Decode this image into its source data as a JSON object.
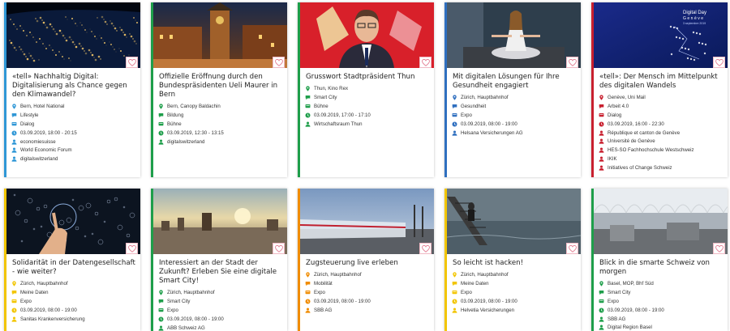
{
  "cards": [
    {
      "title": "«tell» Nachhaltig Digital: Digitalisierung als Chance gegen den Klimawandel?",
      "accent": "#2f97d6",
      "image": "night-earth",
      "meta": [
        {
          "icon": "location-pin-icon",
          "text": "Bern, Hotel National"
        },
        {
          "icon": "category-icon",
          "text": "Lifestyle"
        },
        {
          "icon": "format-icon",
          "text": "Dialog"
        },
        {
          "icon": "clock-icon",
          "text": "03.09.2019, 18:00 - 20:15"
        },
        {
          "icon": "organizer-icon",
          "text": "economiesuisse"
        },
        {
          "icon": "organizer-icon",
          "text": "World Economic Forum"
        },
        {
          "icon": "organizer-icon",
          "text": "digitalswitzerland"
        }
      ]
    },
    {
      "title": "Offizielle Eröffnung durch den Bundespräsidenten Ueli Maurer in Bern",
      "accent": "#1e9e4a",
      "image": "bern-clock-tower",
      "meta": [
        {
          "icon": "location-pin-icon",
          "text": "Bern, Canopy Baldachin"
        },
        {
          "icon": "category-icon",
          "text": "Bildung"
        },
        {
          "icon": "format-icon",
          "text": "Bühne"
        },
        {
          "icon": "clock-icon",
          "text": "03.09.2019, 12:30 - 13:15"
        },
        {
          "icon": "organizer-icon",
          "text": "digitalswitzerland"
        }
      ]
    },
    {
      "title": "Grusswort Stadtpräsident Thun",
      "accent": "#1e9e4a",
      "image": "portrait-flag",
      "meta": [
        {
          "icon": "location-pin-icon",
          "text": "Thun, Kino Rex"
        },
        {
          "icon": "category-icon",
          "text": "Smart City"
        },
        {
          "icon": "format-icon",
          "text": "Bühne"
        },
        {
          "icon": "clock-icon",
          "text": "03.09.2019, 17:00 - 17:10"
        },
        {
          "icon": "organizer-icon",
          "text": "Wirtschaftsraum Thun"
        }
      ]
    },
    {
      "title": "Mit digitalen Lösungen für Ihre Gesundheit engagiert",
      "accent": "#2f6fbf",
      "image": "meditation",
      "meta": [
        {
          "icon": "location-pin-icon",
          "text": "Zürich, Hauptbahnhof"
        },
        {
          "icon": "category-icon",
          "text": "Gesundheit"
        },
        {
          "icon": "format-icon",
          "text": "Expo"
        },
        {
          "icon": "clock-icon",
          "text": "03.09.2019, 08:00 - 19:00"
        },
        {
          "icon": "organizer-icon",
          "text": "Helsana Versicherungen AG"
        }
      ]
    },
    {
      "title": "«tell»: Der Mensch im Mittelpunkt des digitalen Wandels",
      "accent": "#c8202f",
      "image": "digital-day-geneve",
      "image_lines": [
        "Digital Day",
        "Genève",
        "3 septembre 2019"
      ],
      "meta": [
        {
          "icon": "location-pin-icon",
          "text": "Genève, Uni Mail"
        },
        {
          "icon": "category-icon",
          "text": "Arbeit 4.0"
        },
        {
          "icon": "format-icon",
          "text": "Dialog"
        },
        {
          "icon": "clock-icon",
          "text": "03.09.2019, 16:00 - 22:30"
        },
        {
          "icon": "organizer-icon",
          "text": "République et canton de Genève"
        },
        {
          "icon": "organizer-icon",
          "text": "Université de Genève"
        },
        {
          "icon": "organizer-icon",
          "text": "HES-SO Fachhochschule Westschweiz"
        },
        {
          "icon": "organizer-icon",
          "text": "IKIK"
        },
        {
          "icon": "organizer-icon",
          "text": "Initiatives of Change Schweiz"
        }
      ]
    },
    {
      "title": "Solidarität in der Datengesellschaft - wie weiter?",
      "accent": "#f2c500",
      "image": "data-hand",
      "meta": [
        {
          "icon": "location-pin-icon",
          "text": "Zürich, Hauptbahnhof"
        },
        {
          "icon": "category-icon",
          "text": "Meine Daten"
        },
        {
          "icon": "format-icon",
          "text": "Expo"
        },
        {
          "icon": "clock-icon",
          "text": "03.09.2019, 08:00 - 19:00"
        },
        {
          "icon": "organizer-icon",
          "text": "Sanitas Krankenversicherung"
        }
      ]
    },
    {
      "title": "Interessiert an der Stadt der Zukunft? Erleben Sie eine digitale Smart City!",
      "accent": "#1e9e4a",
      "image": "city-sunset",
      "meta": [
        {
          "icon": "location-pin-icon",
          "text": "Zürich, Hauptbahnhof"
        },
        {
          "icon": "category-icon",
          "text": "Smart City"
        },
        {
          "icon": "format-icon",
          "text": "Expo"
        },
        {
          "icon": "clock-icon",
          "text": "03.09.2019, 08:00 - 19:00"
        },
        {
          "icon": "organizer-icon",
          "text": "ABB Schweiz AG"
        }
      ]
    },
    {
      "title": "Zugsteuerung live erleben",
      "accent": "#f08c00",
      "image": "train-motion",
      "meta": [
        {
          "icon": "location-pin-icon",
          "text": "Zürich, Hauptbahnhof"
        },
        {
          "icon": "category-icon",
          "text": "Mobilität"
        },
        {
          "icon": "format-icon",
          "text": "Expo"
        },
        {
          "icon": "clock-icon",
          "text": "03.09.2019, 08:00 - 19:00"
        },
        {
          "icon": "organizer-icon",
          "text": "SBB AG"
        }
      ]
    },
    {
      "title": "So leicht ist hacken!",
      "accent": "#f2c500",
      "image": "flood",
      "meta": [
        {
          "icon": "location-pin-icon",
          "text": "Zürich, Hauptbahnhof"
        },
        {
          "icon": "category-icon",
          "text": "Meine Daten"
        },
        {
          "icon": "format-icon",
          "text": "Expo"
        },
        {
          "icon": "clock-icon",
          "text": "03.09.2019, 08:00 - 19:00"
        },
        {
          "icon": "organizer-icon",
          "text": "Helvetia Versicherungen"
        }
      ]
    },
    {
      "title": "Blick in die smarte Schweiz von morgen",
      "accent": "#1e9e4a",
      "image": "station-hall",
      "meta": [
        {
          "icon": "location-pin-icon",
          "text": "Basel, MOP, Bhf Süd"
        },
        {
          "icon": "category-icon",
          "text": "Smart City"
        },
        {
          "icon": "format-icon",
          "text": "Expo"
        },
        {
          "icon": "clock-icon",
          "text": "03.09.2019, 08:00 - 19:00"
        },
        {
          "icon": "organizer-icon",
          "text": "SBB AG"
        },
        {
          "icon": "organizer-icon",
          "text": "Digital Region Basel"
        }
      ]
    }
  ]
}
